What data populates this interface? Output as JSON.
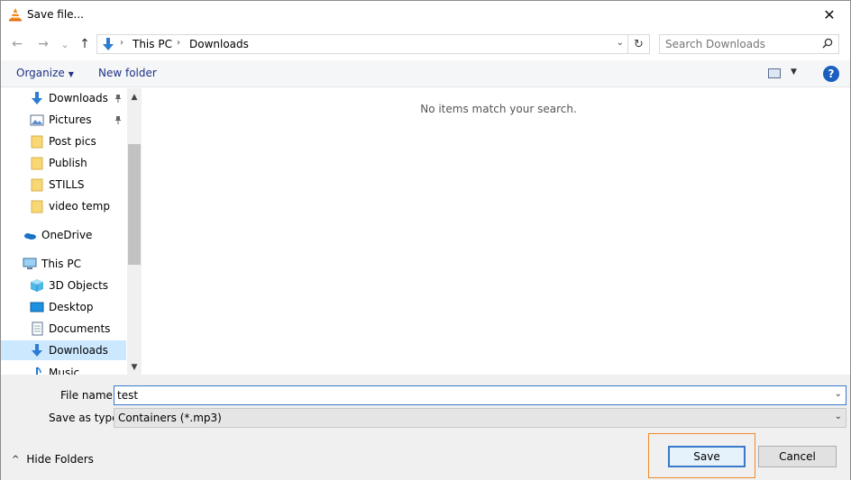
{
  "window": {
    "title": "Save file...",
    "close_glyph": "✕"
  },
  "nav": {
    "back_glyph": "←",
    "forward_glyph": "→",
    "recent_glyph": "⌄",
    "up_glyph": "↑",
    "breadcrumb": [
      "This PC",
      "Downloads"
    ],
    "crumb_separator": "›",
    "dropdown_glyph": "⌄",
    "refresh_glyph": "↻"
  },
  "search": {
    "placeholder": "Search Downloads",
    "icon": "search-icon"
  },
  "toolbar": {
    "organize": "Organize",
    "organize_caret": "▼",
    "new_folder": "New folder",
    "view_caret": "▼",
    "help": "?"
  },
  "nav_pane": {
    "items": [
      {
        "label": "Downloads",
        "icon": "download-arrow-icon",
        "pinned": true,
        "indent": 1,
        "selected": false
      },
      {
        "label": "Pictures",
        "icon": "pictures-icon",
        "pinned": true,
        "indent": 1,
        "selected": false
      },
      {
        "label": "Post pics",
        "icon": "folder-icon",
        "pinned": false,
        "indent": 1,
        "selected": false
      },
      {
        "label": "Publish",
        "icon": "folder-icon",
        "pinned": false,
        "indent": 1,
        "selected": false
      },
      {
        "label": "STILLS",
        "icon": "folder-icon",
        "pinned": false,
        "indent": 1,
        "selected": false
      },
      {
        "label": "video temp",
        "icon": "folder-icon",
        "pinned": false,
        "indent": 1,
        "selected": false
      },
      {
        "label": "OneDrive",
        "icon": "onedrive-cloud-icon",
        "pinned": false,
        "indent": 0,
        "selected": false
      },
      {
        "label": "This PC",
        "icon": "computer-icon",
        "pinned": false,
        "indent": 0,
        "selected": false
      },
      {
        "label": "3D Objects",
        "icon": "cube-icon",
        "pinned": false,
        "indent": 1,
        "selected": false
      },
      {
        "label": "Desktop",
        "icon": "desktop-icon",
        "pinned": false,
        "indent": 1,
        "selected": false
      },
      {
        "label": "Documents",
        "icon": "document-icon",
        "pinned": false,
        "indent": 1,
        "selected": false
      },
      {
        "label": "Downloads",
        "icon": "download-arrow-icon",
        "pinned": false,
        "indent": 1,
        "selected": true
      },
      {
        "label": "Music",
        "icon": "music-note-icon",
        "pinned": false,
        "indent": 1,
        "selected": false
      }
    ],
    "pin_glyph": "📌",
    "scroll_up_glyph": "▲",
    "scroll_down_glyph": "▼"
  },
  "main": {
    "empty_message": "No items match your search."
  },
  "bottom": {
    "file_name_label": "File name:",
    "file_name_value": "test",
    "save_as_type_label": "Save as type:",
    "save_as_type_value": "Containers (*.mp3)",
    "dropdown_glyph": "⌄",
    "hide_folders_label": "Hide Folders",
    "hide_folders_glyph": "^",
    "save_label": "Save",
    "cancel_label": "Cancel"
  },
  "colors": {
    "accent": "#3a78c9",
    "focus_outline": "#ef8a2d",
    "link": "#1e3287",
    "selection": "#cce8ff",
    "folder": "#f8d775"
  }
}
